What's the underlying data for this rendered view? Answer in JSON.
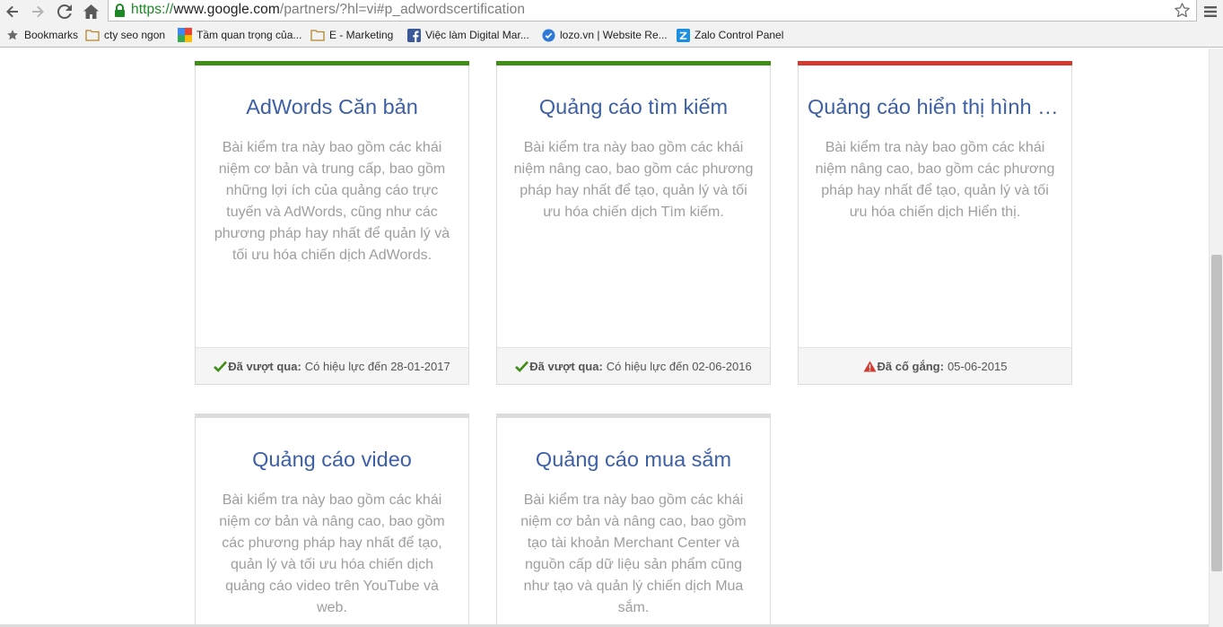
{
  "browser": {
    "url": {
      "scheme": "https://",
      "host": "www.google.com",
      "path": "/partners/?hl=vi#p_adwordscertification"
    },
    "bookmarks": [
      {
        "label": "Bookmarks",
        "icon": "star-icon"
      },
      {
        "label": "cty seo ngon",
        "icon": "folder-icon"
      },
      {
        "label": "Tầm quan trọng của...",
        "icon": "google-plus-icon"
      },
      {
        "label": "E - Marketing",
        "icon": "folder-icon"
      },
      {
        "label": "Việc làm Digital Mar...",
        "icon": "facebook-icon"
      },
      {
        "label": "lozo.vn | Website Re...",
        "icon": "lozo-icon"
      },
      {
        "label": "Zalo Control Panel",
        "icon": "zalo-icon"
      }
    ]
  },
  "colors": {
    "passed": "#3f8c17",
    "attempted": "#d23a2f",
    "pending": "#dcdcdc",
    "title": "#3d5fa5"
  },
  "cards": [
    {
      "title": "AdWords Căn bản",
      "description": "Bài kiểm tra này bao gồm các khái niệm cơ bản và trung cấp, bao gồm những lợi ích của quảng cáo trực tuyến và AdWords, cũng như các phương pháp hay nhất để quản lý và tối ưu hóa chiến dịch AdWords.",
      "status": "passed",
      "status_label": "Đã vượt qua:",
      "status_value": "Có hiệu lực đến 28-01-2017"
    },
    {
      "title": "Quảng cáo tìm kiếm",
      "description": "Bài kiểm tra này bao gồm các khái niệm nâng cao, bao gồm các phương pháp hay nhất để tạo, quản lý và tối ưu hóa chiến dịch Tìm kiếm.",
      "status": "passed",
      "status_label": "Đã vượt qua:",
      "status_value": "Có hiệu lực đến 02-06-2016"
    },
    {
      "title": "Quảng cáo hiển thị hình ả...",
      "description": "Bài kiểm tra này bao gồm các khái niệm nâng cao, bao gồm các phương pháp hay nhất để tạo, quản lý và tối ưu hóa chiến dịch Hiển thị.",
      "status": "attempted",
      "status_label": "Đã cố gắng:",
      "status_value": "05-06-2015"
    },
    {
      "title": "Quảng cáo video",
      "description": "Bài kiểm tra này bao gồm các khái niệm cơ bản và nâng cao, bao gồm các phương pháp hay nhất để tạo, quản lý và tối ưu hóa chiến dịch quảng cáo video trên YouTube và web.",
      "status": "pending"
    },
    {
      "title": "Quảng cáo mua sắm",
      "description": "Bài kiểm tra này bao gồm các khái niệm cơ bản và nâng cao, bao gồm tạo tài khoản Merchant Center và nguồn cấp dữ liệu sản phẩm cũng như tạo và quản lý chiến dịch Mua sắm.",
      "status": "pending"
    }
  ]
}
